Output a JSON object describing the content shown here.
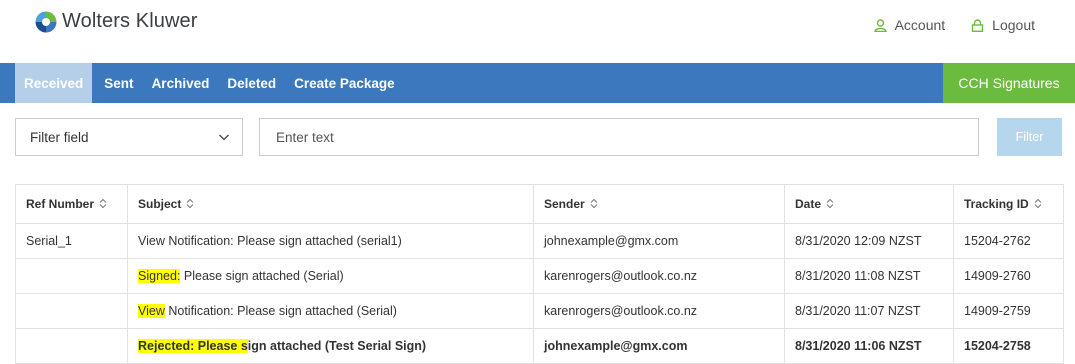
{
  "header": {
    "brand": "Wolters Kluwer",
    "account_label": "Account",
    "logout_label": "Logout"
  },
  "nav": {
    "items": [
      {
        "label": "Received",
        "active": true
      },
      {
        "label": "Sent"
      },
      {
        "label": "Archived"
      },
      {
        "label": "Deleted"
      },
      {
        "label": "Create Package"
      }
    ],
    "cch_label": "CCH Signatures"
  },
  "filter": {
    "select_value": "Filter field",
    "input_placeholder": "Enter text",
    "button_label": "Filter"
  },
  "table": {
    "columns": [
      "Ref Number",
      "Subject",
      "Sender",
      "Date",
      "Tracking ID"
    ],
    "rows": [
      {
        "ref": "Serial_1",
        "subject_hl": "",
        "subject_rest": "View Notification: Please sign attached (serial1)",
        "sender": "johnexample@gmx.com",
        "date": "8/31/2020 12:09 NZST",
        "tracking": "15204-2762",
        "bold": false
      },
      {
        "ref": "",
        "subject_hl": "Signed:",
        "subject_rest": " Please sign attached (Serial)",
        "sender": "karenrogers@outlook.co.nz",
        "date": "8/31/2020 11:08 NZST",
        "tracking": "14909-2760",
        "bold": false
      },
      {
        "ref": "",
        "subject_hl": "View",
        "subject_rest": " Notification: Please sign attached (Serial)",
        "sender": "karenrogers@outlook.co.nz",
        "date": "8/31/2020 11:07 NZST",
        "tracking": "14909-2759",
        "bold": false
      },
      {
        "ref": "",
        "subject_hl": "Rejected: Please s",
        "subject_rest": "ign attached (Test Serial Sign)",
        "sender": "johnexample@gmx.com",
        "date": "8/31/2020 11:06 NZST",
        "tracking": "15204-2758",
        "bold": true
      }
    ]
  },
  "colors": {
    "nav_bg": "#3b78bd",
    "nav_active_bg": "#b5cfe8",
    "cch_bg": "#6bbb3f",
    "filter_btn_bg": "#b5d6ec",
    "highlight": "#ffff00",
    "icon_green": "#6bbb3f"
  },
  "icons": {
    "logo": "wolters-kluwer-logo",
    "account": "user-icon",
    "logout": "lock-icon",
    "select": "chevron-down-icon",
    "sort": "sort-icon"
  }
}
